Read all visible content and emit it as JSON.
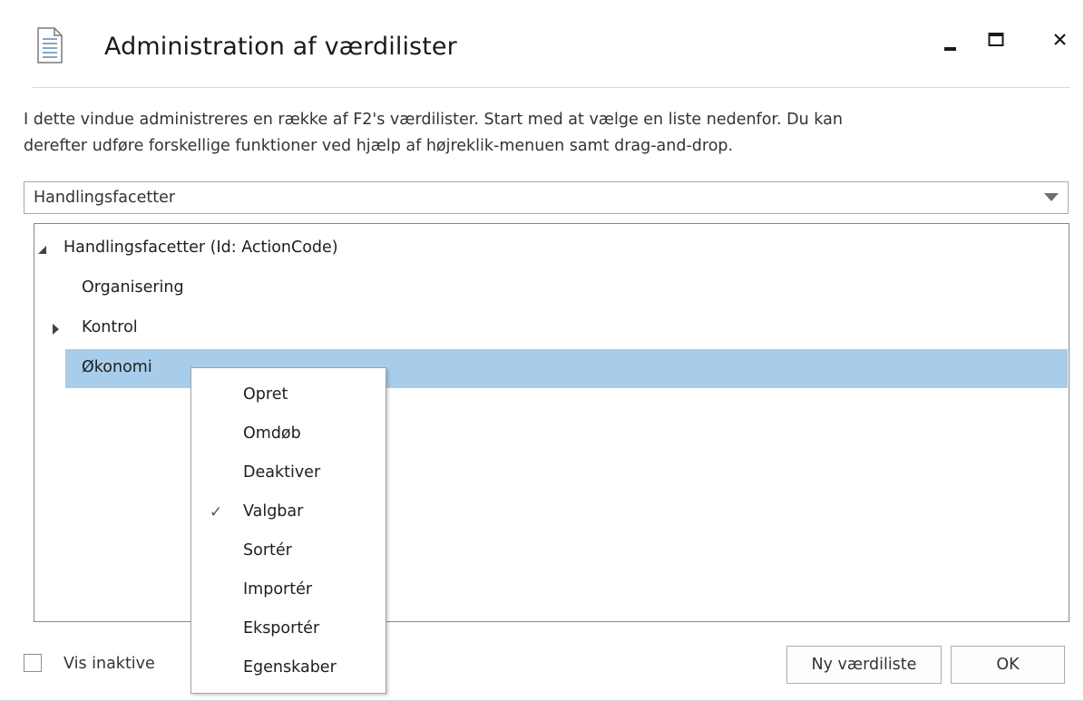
{
  "window": {
    "title": "Administration af værdilister",
    "controls": {
      "minimize": "minimize-icon",
      "maximize": "maximize-icon",
      "close": "close-icon"
    }
  },
  "description": {
    "line1": "I dette vindue administreres en række af F2's værdilister. Start med at vælge en liste nedenfor. Du kan",
    "line2": "derefter udføre forskellige funktioner ved hjælp af højreklik-menuen samt drag-and-drop."
  },
  "list_selector": {
    "selected": "Handlingsfacetter"
  },
  "tree": {
    "root": "Handlingsfacetter (Id: ActionCode)",
    "items": [
      {
        "label": "Organisering",
        "expandable": false
      },
      {
        "label": "Kontrol",
        "expandable": true
      },
      {
        "label": "Økonomi",
        "selected": true
      }
    ]
  },
  "context_menu": {
    "items": [
      {
        "label": "Opret",
        "checked": false
      },
      {
        "label": "Omdøb",
        "checked": false
      },
      {
        "label": "Deaktiver",
        "checked": false
      },
      {
        "label": "Valgbar",
        "checked": true,
        "check_glyph": "✓"
      },
      {
        "label": "Sortér",
        "checked": false
      },
      {
        "label": "Importér",
        "checked": false
      },
      {
        "label": "Eksportér",
        "checked": false
      },
      {
        "label": "Egenskaber",
        "checked": false
      }
    ]
  },
  "footer": {
    "show_inactive_label": "Vis inaktive",
    "show_inactive_checked": false,
    "new_list_button": "Ny værdiliste",
    "ok_button": "OK"
  },
  "colors": {
    "selection": "#a8cdea",
    "border": "#828790"
  }
}
